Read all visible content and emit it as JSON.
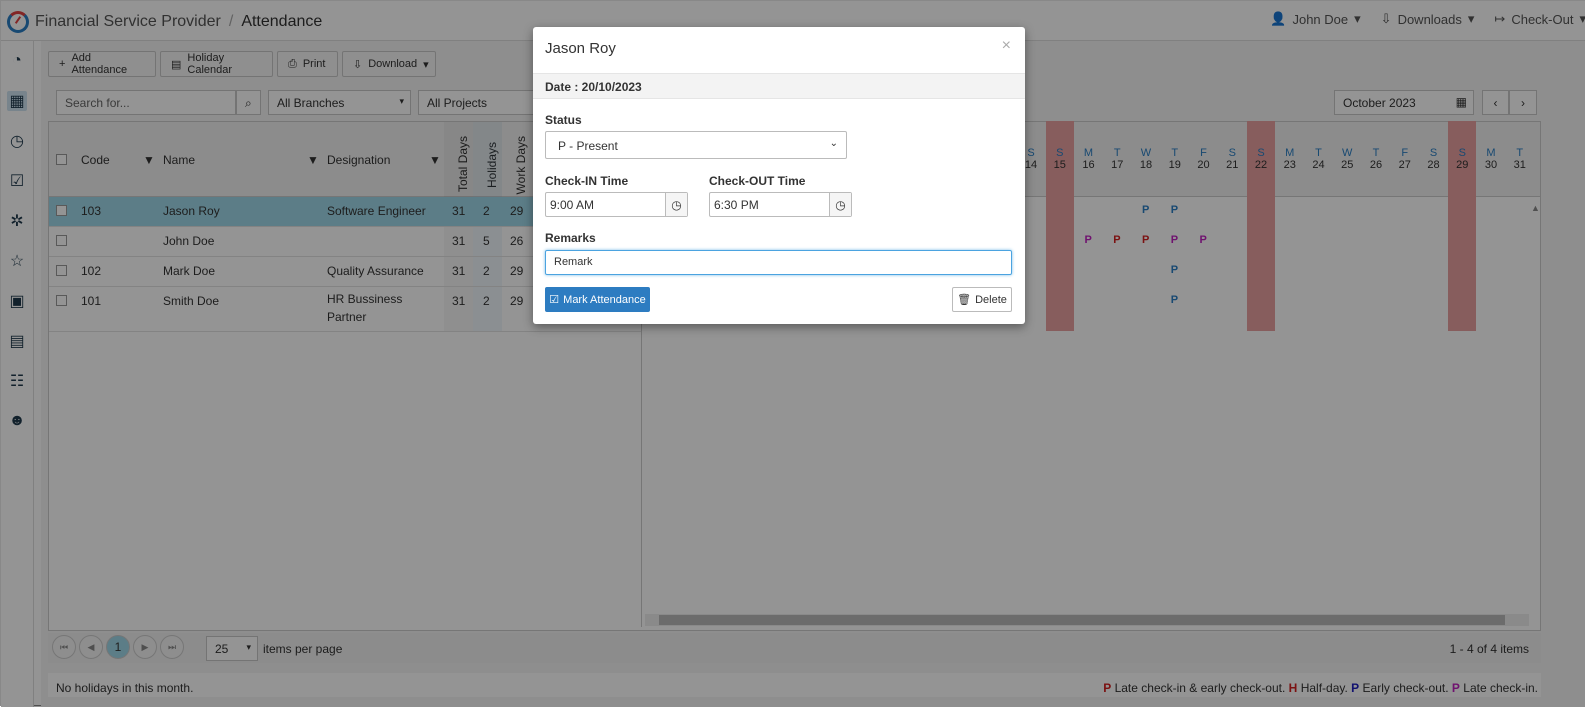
{
  "app": {
    "title": "Financial Service Provider",
    "page": "Attendance"
  },
  "user": {
    "name": "John Doe",
    "downloads": "Downloads",
    "checkout": "Check-Out"
  },
  "toolbar": {
    "add": "Add Attendance",
    "holiday": "Holiday Calendar",
    "print": "Print",
    "download": "Download"
  },
  "filters": {
    "search_placeholder": "Search for...",
    "branches": "All Branches",
    "projects": "All Projects",
    "month": "October 2023"
  },
  "columns": {
    "code": "Code",
    "name": "Name",
    "designation": "Designation",
    "total": "Total Days",
    "holidays": "Holidays",
    "work": "Work Days"
  },
  "rows": [
    {
      "code": "103",
      "name": "Jason Roy",
      "designation": "Software Engineer",
      "total": "31",
      "holidays": "2",
      "work": "29"
    },
    {
      "code": "",
      "name": "John Doe",
      "designation": "",
      "total": "31",
      "holidays": "5",
      "work": "26"
    },
    {
      "code": "102",
      "name": "Mark Doe",
      "designation": "Quality Assurance",
      "total": "31",
      "holidays": "2",
      "work": "29"
    },
    {
      "code": "101",
      "name": "Smith Doe",
      "designation": "HR Bussiness Partner",
      "total": "31",
      "holidays": "2",
      "work": "29"
    }
  ],
  "days": [
    {
      "l": "S",
      "n": "14"
    },
    {
      "l": "S",
      "n": "15"
    },
    {
      "l": "M",
      "n": "16"
    },
    {
      "l": "T",
      "n": "17"
    },
    {
      "l": "W",
      "n": "18"
    },
    {
      "l": "T",
      "n": "19"
    },
    {
      "l": "F",
      "n": "20"
    },
    {
      "l": "S",
      "n": "21"
    },
    {
      "l": "S",
      "n": "22"
    },
    {
      "l": "M",
      "n": "23"
    },
    {
      "l": "T",
      "n": "24"
    },
    {
      "l": "W",
      "n": "25"
    },
    {
      "l": "T",
      "n": "26"
    },
    {
      "l": "F",
      "n": "27"
    },
    {
      "l": "S",
      "n": "28"
    },
    {
      "l": "S",
      "n": "29"
    },
    {
      "l": "M",
      "n": "30"
    },
    {
      "l": "T",
      "n": "31"
    }
  ],
  "pager": {
    "page": "1",
    "size": "25",
    "label": "items per page",
    "summary": "1 - 4 of 4 items"
  },
  "footer": {
    "holidays": "No holidays in this month.",
    "legend": "Late check-in & early check-out.",
    "half": "Half-day.",
    "early": "Early check-out.",
    "late": "Late check-in."
  },
  "modal": {
    "title": "Jason Roy",
    "date": "Date : 20/10/2023",
    "status_label": "Status",
    "status": "P - Present",
    "checkin_label": "Check-IN Time",
    "checkin": "9:00 AM",
    "checkout_label": "Check-OUT Time",
    "checkout": "6:30 PM",
    "remarks_label": "Remarks",
    "remarks": "Remark",
    "mark": "Mark Attendance",
    "delete": "Delete"
  },
  "marks": {
    "p": "P",
    "h": "H"
  }
}
